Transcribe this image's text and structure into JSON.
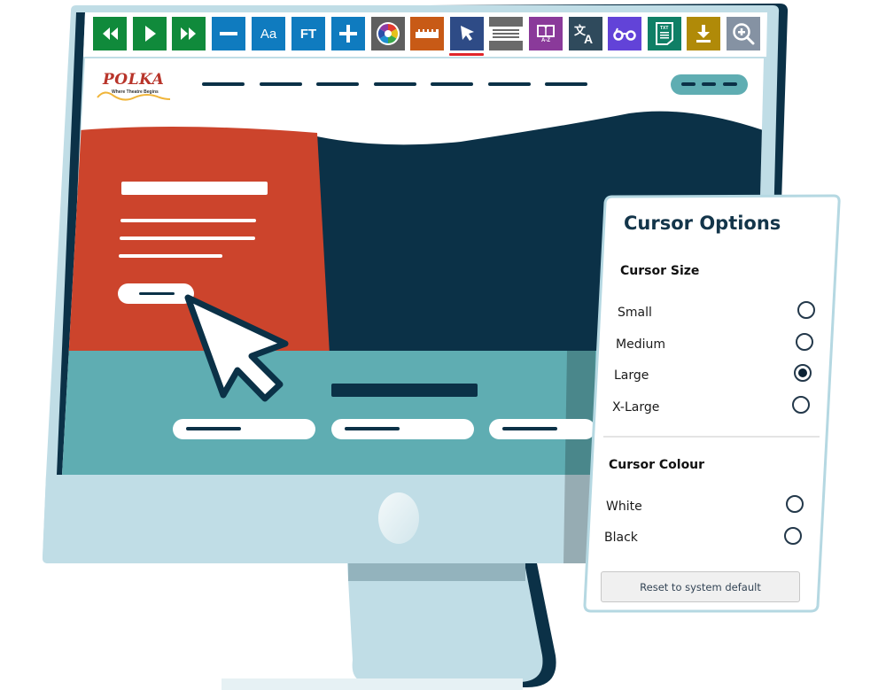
{
  "toolbar": {
    "buttons": [
      {
        "id": "rewind",
        "icon": "rewind-icon",
        "label": "",
        "color": "#108a3b"
      },
      {
        "id": "play",
        "icon": "play-icon",
        "label": "",
        "color": "#108a3b"
      },
      {
        "id": "fast-forward",
        "icon": "fast-forward-icon",
        "label": "",
        "color": "#108a3b"
      },
      {
        "id": "decrease-text",
        "icon": "minus-icon",
        "label": "",
        "color": "#0f7bbf"
      },
      {
        "id": "font-style",
        "icon": "font-icon",
        "label": "Aa",
        "color": "#0f7bbf"
      },
      {
        "id": "font-type",
        "icon": "font-type-icon",
        "label": "FT",
        "color": "#0f7bbf"
      },
      {
        "id": "increase-text",
        "icon": "plus-icon",
        "label": "",
        "color": "#0f7bbf"
      },
      {
        "id": "colour",
        "icon": "colour-wheel-icon",
        "label": "",
        "color": "#5f5f5f"
      },
      {
        "id": "ruler",
        "icon": "ruler-icon",
        "label": "",
        "color": "#c85a16"
      },
      {
        "id": "cursor",
        "icon": "cursor-icon",
        "label": "",
        "color": "#2e4b86",
        "active": true
      },
      {
        "id": "screen-mask",
        "icon": "screen-mask-icon",
        "label": "",
        "color": "#6a6a6a"
      },
      {
        "id": "dictionary",
        "icon": "dictionary-icon",
        "label": "A-Z",
        "color": "#8a3a9a"
      },
      {
        "id": "translate",
        "icon": "translate-icon",
        "label": "",
        "color": "#2f4a5c"
      },
      {
        "id": "reader",
        "icon": "glasses-icon",
        "label": "",
        "color": "#6243d8"
      },
      {
        "id": "text-file",
        "icon": "text-file-icon",
        "label": "TXT",
        "color": "#0f7f66"
      },
      {
        "id": "download",
        "icon": "download-icon",
        "label": "",
        "color": "#b08a08"
      },
      {
        "id": "magnifier",
        "icon": "zoom-in-icon",
        "label": "",
        "color": "#8592a3"
      }
    ]
  },
  "site": {
    "logo_name": "POLKA",
    "logo_tagline": "Where Theatre Begins",
    "colors": {
      "dark": "#0b3147",
      "orange": "#cc442c",
      "teal": "#5fadb2",
      "bezel": "#c0dde6",
      "stand_shadow": "#93b3bd"
    }
  },
  "panel": {
    "title": "Cursor Options",
    "size_section": {
      "heading": "Cursor Size",
      "options": [
        {
          "label": "Small",
          "checked": false
        },
        {
          "label": "Medium",
          "checked": false
        },
        {
          "label": "Large",
          "checked": true
        },
        {
          "label": "X-Large",
          "checked": false
        }
      ]
    },
    "colour_section": {
      "heading": "Cursor Colour",
      "options": [
        {
          "label": "White",
          "checked": false
        },
        {
          "label": "Black",
          "checked": false
        }
      ]
    },
    "reset_label": "Reset to system default"
  }
}
